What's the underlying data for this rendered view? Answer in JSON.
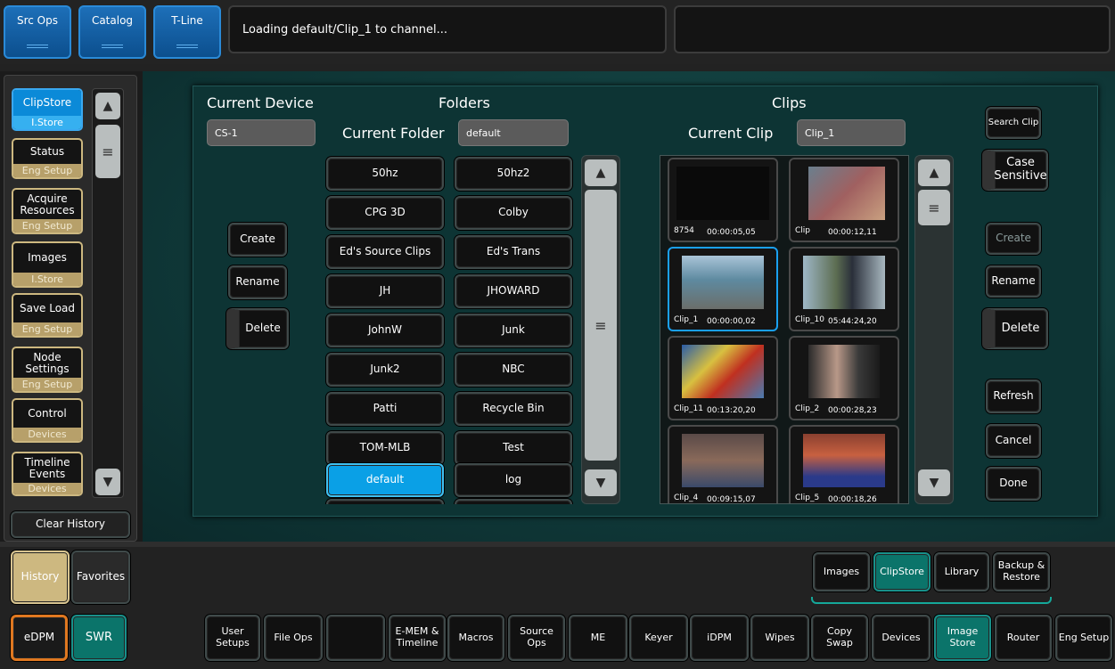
{
  "top_tabs": [
    "Src Ops",
    "Catalog",
    "T-Line"
  ],
  "status_message": "Loading default/Clip_1 to channel...",
  "sidebar": {
    "items": [
      {
        "label": "ClipStore",
        "sub": "I.Store"
      },
      {
        "label": "Status",
        "sub": "Eng Setup"
      },
      {
        "label": "Acquire Resources",
        "sub": "Eng Setup"
      },
      {
        "label": "Images",
        "sub": "I.Store"
      },
      {
        "label": "Save Load",
        "sub": "Eng Setup"
      },
      {
        "label": "Node Settings",
        "sub": "Eng Setup"
      },
      {
        "label": "Control",
        "sub": "Devices"
      },
      {
        "label": "Timeline Events",
        "sub": "Devices"
      }
    ],
    "clear_history": "Clear History",
    "history": "History",
    "favorites": "Favorites",
    "edpm": "eDPM",
    "swr": "SWR"
  },
  "device": {
    "heading": "Current Device",
    "value": "CS-1",
    "create": "Create",
    "rename": "Rename",
    "delete": "Delete"
  },
  "folders": {
    "heading": "Folders",
    "current_label": "Current Folder",
    "current_value": "default",
    "items": [
      "50hz",
      "50hz2",
      "CPG 3D",
      "Colby",
      "Ed's Source Clips",
      "Ed's Trans",
      "JH",
      "JHOWARD",
      "JohnW",
      "Junk",
      "Junk2",
      "NBC",
      "Patti",
      "Recycle Bin",
      "TOM-MLB",
      "Test",
      "default",
      "log"
    ],
    "selected": "default"
  },
  "clips": {
    "heading": "Clips",
    "current_label": "Current Clip",
    "current_value": "Clip_1",
    "items": [
      {
        "name": "8754",
        "time": "00:00:05,05"
      },
      {
        "name": "Clip",
        "time": "00:00:12,11"
      },
      {
        "name": "Clip_1",
        "time": "00:00:00,02"
      },
      {
        "name": "Clip_10",
        "time": "05:44:24,20"
      },
      {
        "name": "Clip_11",
        "time": "00:13:20,20"
      },
      {
        "name": "Clip_2",
        "time": "00:00:28,23"
      },
      {
        "name": "Clip_4",
        "time": "00:09:15,07"
      },
      {
        "name": "Clip_5",
        "time": "00:00:18,26"
      }
    ],
    "selected": "Clip_1"
  },
  "clip_actions": {
    "search": "Search Clip",
    "case_sensitive": "Case Sensitive",
    "create": "Create",
    "rename": "Rename",
    "delete": "Delete",
    "refresh": "Refresh",
    "cancel": "Cancel",
    "done": "Done"
  },
  "subtabs": [
    "Images",
    "ClipStore",
    "Library",
    "Backup & Restore"
  ],
  "bottom_tabs": [
    "User Setups",
    "File Ops",
    "",
    "E-MEM & Timeline",
    "Macros",
    "Source Ops",
    "ME",
    "Keyer",
    "iDPM",
    "Wipes",
    "Copy Swap",
    "Devices",
    "Image Store",
    "Router",
    "Eng Setup"
  ],
  "colors": {
    "accent_blue": "#0aa0e6",
    "teal": "#0b746a",
    "gold": "#b7a06a"
  }
}
